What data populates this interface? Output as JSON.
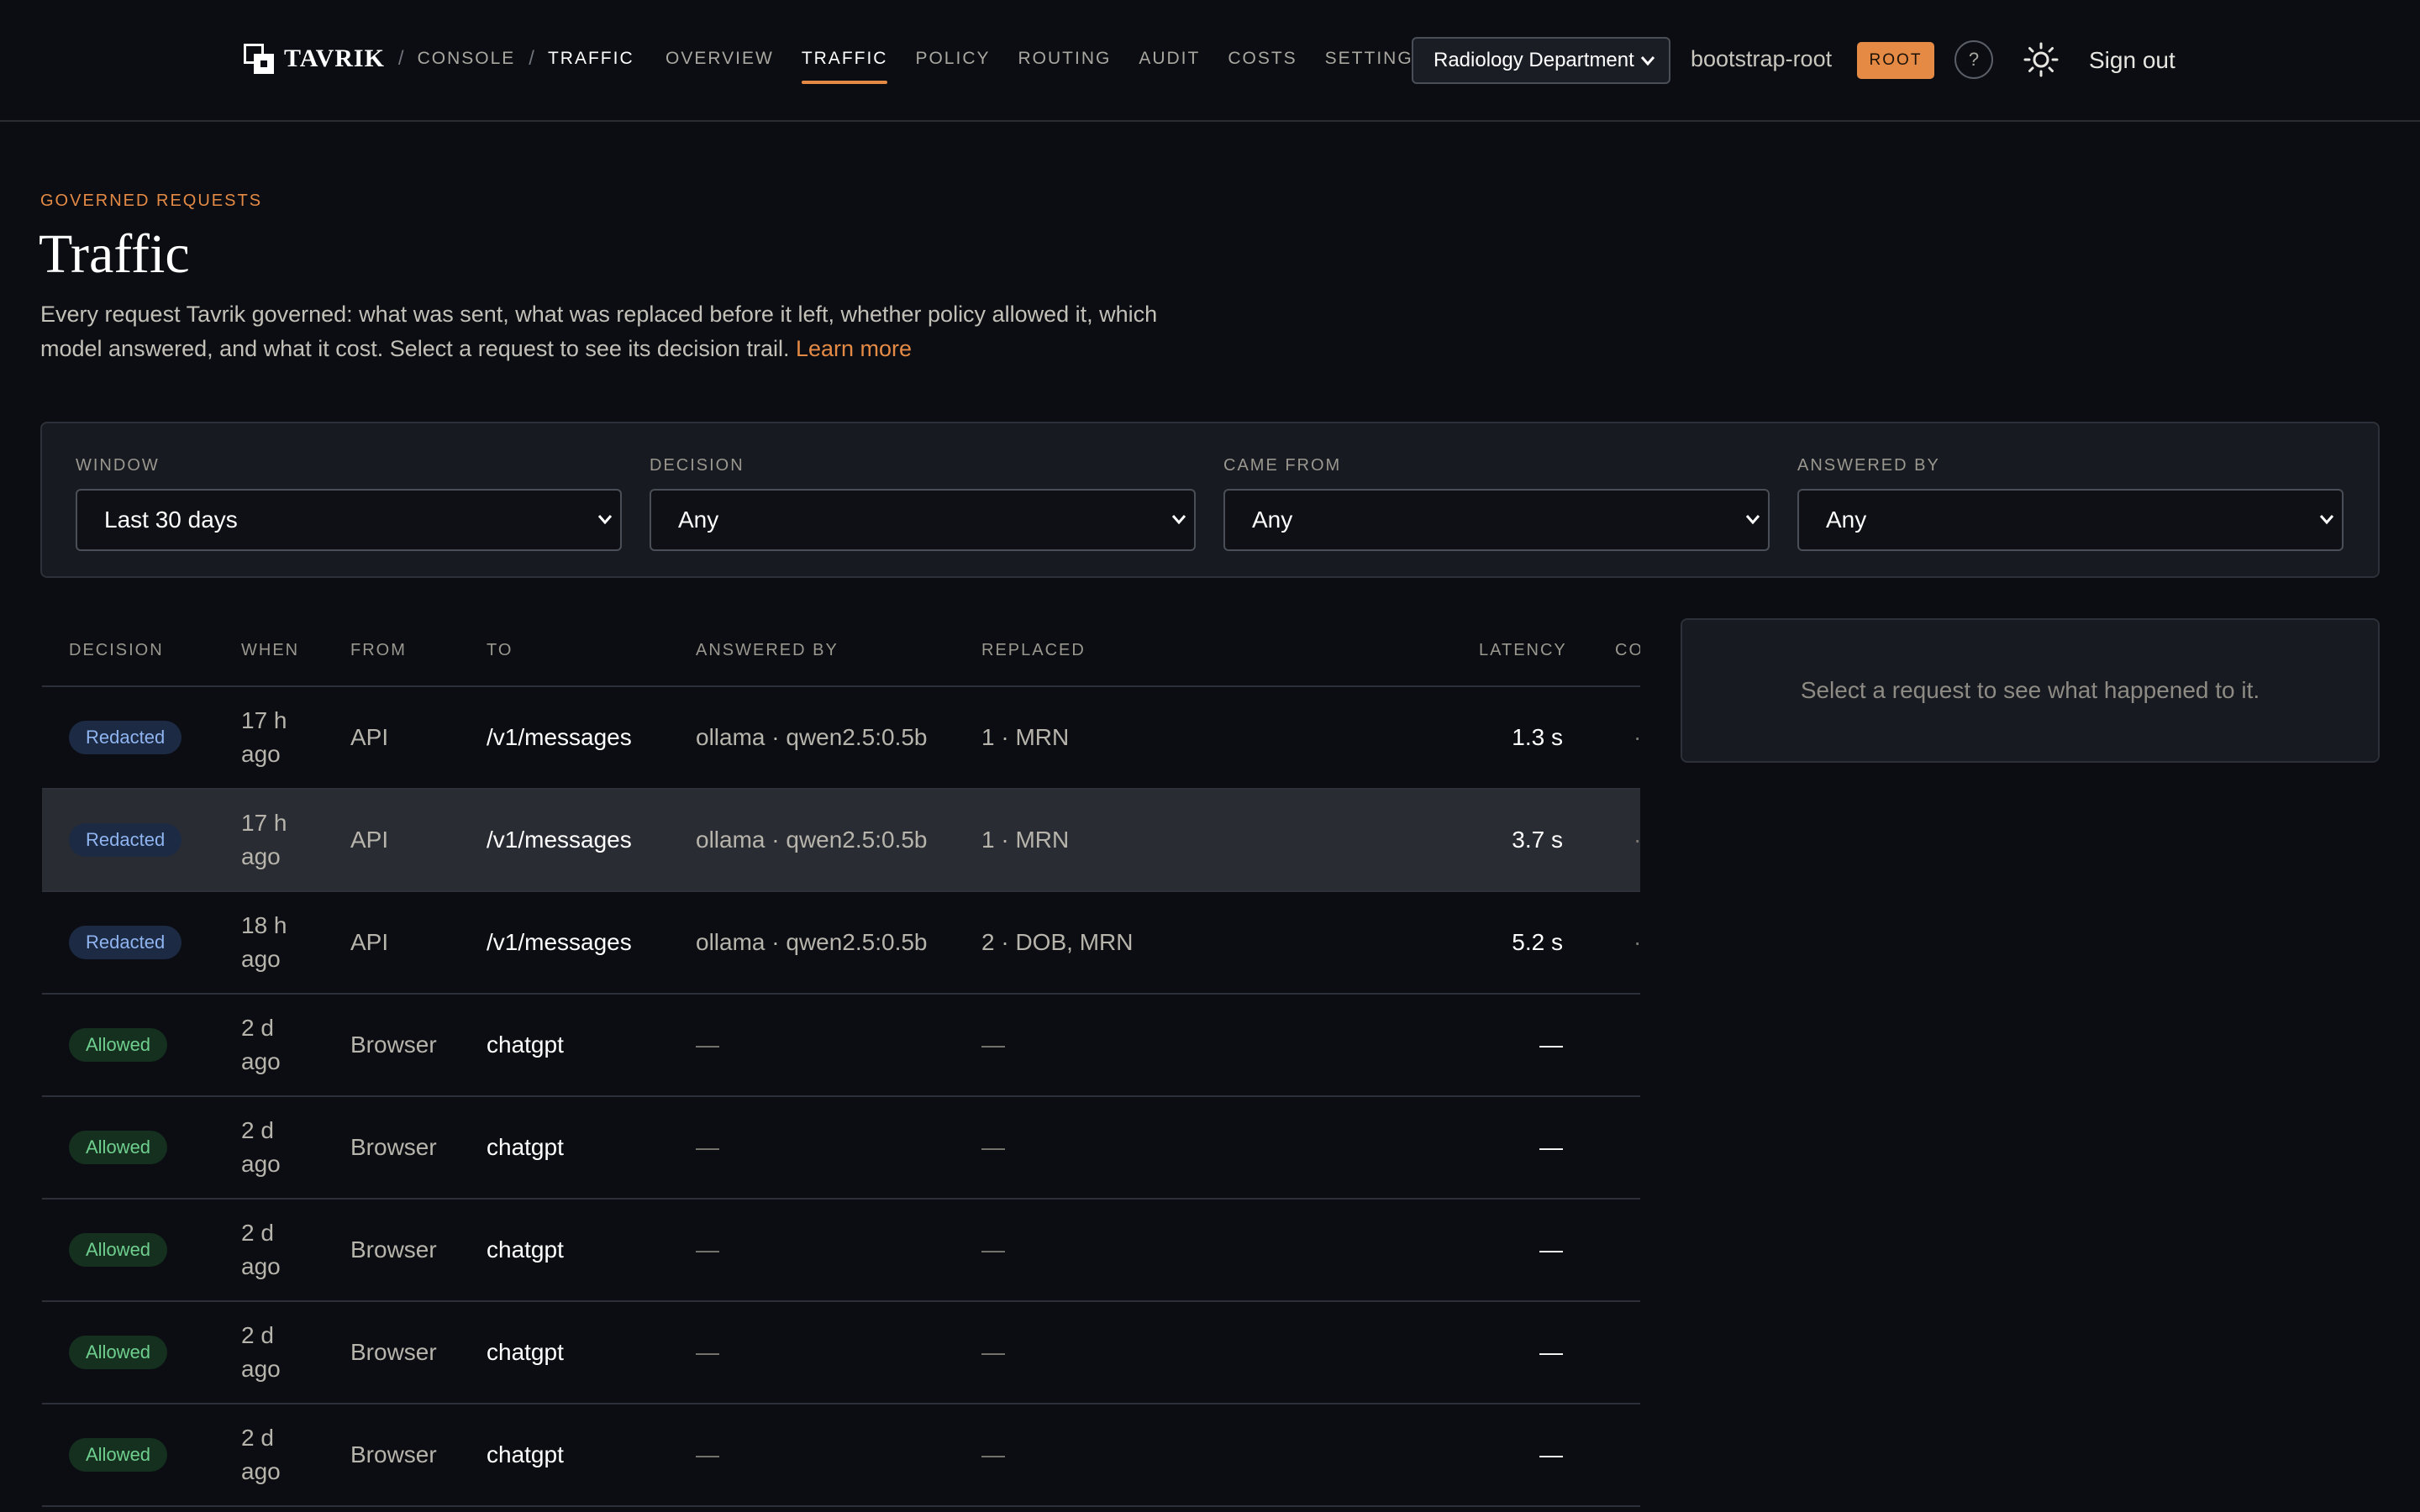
{
  "header": {
    "brand": "TAVRIK",
    "breadcrumb": [
      "CONSOLE",
      "TRAFFIC"
    ],
    "nav": [
      "OVERVIEW",
      "TRAFFIC",
      "POLICY",
      "ROUTING",
      "AUDIT",
      "COSTS",
      "SETTINGS"
    ],
    "active_nav": "TRAFFIC",
    "department": "Radiology Department",
    "user": "bootstrap-root",
    "role_badge": "ROOT",
    "help_label": "?",
    "signout_label": "Sign out"
  },
  "hero": {
    "eyebrow": "GOVERNED REQUESTS",
    "title": "Traffic",
    "description": "Every request Tavrik governed: what was sent, what was replaced before it left, whether policy allowed it, which model answered, and what it cost. Select a request to see its decision trail.",
    "learn_more": "Learn more"
  },
  "filters": [
    {
      "label": "WINDOW",
      "value": "Last 30 days"
    },
    {
      "label": "DECISION",
      "value": "Any"
    },
    {
      "label": "CAME FROM",
      "value": "Any"
    },
    {
      "label": "ANSWERED BY",
      "value": "Any"
    }
  ],
  "table": {
    "columns": [
      "DECISION",
      "WHEN",
      "FROM",
      "TO",
      "ANSWERED BY",
      "REPLACED",
      "LATENCY",
      "CO"
    ],
    "rows": [
      {
        "decision": "Redacted",
        "when": "17 h ago",
        "from": "API",
        "to": "/v1/messages",
        "answered_by": "ollama · qwen2.5:0.5b",
        "replaced": "1 · MRN",
        "latency": "1.3 s"
      },
      {
        "decision": "Redacted",
        "when": "17 h ago",
        "from": "API",
        "to": "/v1/messages",
        "answered_by": "ollama · qwen2.5:0.5b",
        "replaced": "1 · MRN",
        "latency": "3.7 s"
      },
      {
        "decision": "Redacted",
        "when": "18 h ago",
        "from": "API",
        "to": "/v1/messages",
        "answered_by": "ollama · qwen2.5:0.5b",
        "replaced": "2 · DOB, MRN",
        "latency": "5.2 s"
      },
      {
        "decision": "Allowed",
        "when": "2 d ago",
        "from": "Browser",
        "to": "chatgpt",
        "answered_by": "—",
        "replaced": "—",
        "latency": "—"
      },
      {
        "decision": "Allowed",
        "when": "2 d ago",
        "from": "Browser",
        "to": "chatgpt",
        "answered_by": "—",
        "replaced": "—",
        "latency": "—"
      },
      {
        "decision": "Allowed",
        "when": "2 d ago",
        "from": "Browser",
        "to": "chatgpt",
        "answered_by": "—",
        "replaced": "—",
        "latency": "—"
      },
      {
        "decision": "Allowed",
        "when": "2 d ago",
        "from": "Browser",
        "to": "chatgpt",
        "answered_by": "—",
        "replaced": "—",
        "latency": "—"
      },
      {
        "decision": "Allowed",
        "when": "2 d ago",
        "from": "Browser",
        "to": "chatgpt",
        "answered_by": "—",
        "replaced": "—",
        "latency": "—"
      }
    ]
  },
  "detail": {
    "empty_text": "Select a request to see what happened to it."
  },
  "icons": {
    "logo": "tavrik-logo-icon",
    "theme": "sun-icon",
    "help": "help-icon",
    "dropdown": "chevron-down-icon"
  },
  "colors": {
    "accent": "#e48a45",
    "background": "#0b0d12",
    "redacted_badge": "#8fb4f0",
    "allowed_badge": "#6fcf8e"
  }
}
